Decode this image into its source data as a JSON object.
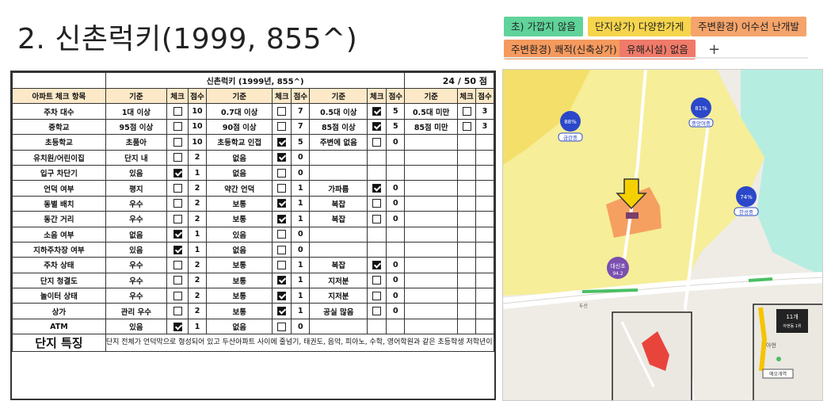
{
  "title": "2. 신촌럭키(1999, 855^)",
  "tags": [
    {
      "label": "초) 가깝지 않음",
      "color": "#5fd39a"
    },
    {
      "label": "단지상가) 다양한가게",
      "color": "#f6d54d"
    },
    {
      "label": "주변환경) 어수선 난개발",
      "color": "#f5a46b"
    },
    {
      "label": "주변환경) 쾌적(신축상가)",
      "color": "#f59a5e"
    },
    {
      "label": "유해시설) 없음",
      "color": "#f07a6a"
    }
  ],
  "tags_plus": "+",
  "checklist": {
    "complex_title": "신촌럭키 (1999년, 855^)",
    "score": "24 / 50 점",
    "headers": {
      "item": "아파트 체크 항목",
      "criteria": "기준",
      "check": "체크",
      "points": "점수"
    },
    "rows": [
      {
        "item": "주차 대수",
        "c": [
          [
            "1대 이상",
            false,
            "10"
          ],
          [
            "0.7대 이상",
            false,
            "7"
          ],
          [
            "0.5대 이상",
            true,
            "5"
          ],
          [
            "0.5대 미만",
            false,
            "3"
          ]
        ]
      },
      {
        "item": "중학교",
        "c": [
          [
            "95점 이상",
            false,
            "10"
          ],
          [
            "90점 이상",
            false,
            "7"
          ],
          [
            "85점 이상",
            true,
            "5"
          ],
          [
            "85점 미만",
            false,
            "3"
          ]
        ]
      },
      {
        "item": "초등학교",
        "c": [
          [
            "초품아",
            false,
            "10"
          ],
          [
            "초등학교 인접",
            true,
            "5"
          ],
          [
            "주변에 없음",
            false,
            "0"
          ],
          null
        ]
      },
      {
        "item": "유치원/어린이집",
        "c": [
          [
            "단지 내",
            false,
            "2"
          ],
          [
            "없음",
            true,
            "0"
          ],
          null,
          null
        ]
      },
      {
        "item": "입구 차단기",
        "c": [
          [
            "있음",
            true,
            "1"
          ],
          [
            "없음",
            false,
            "0"
          ],
          null,
          null
        ]
      },
      {
        "item": "언덕 여부",
        "c": [
          [
            "평지",
            false,
            "2"
          ],
          [
            "약간 언덕",
            false,
            "1"
          ],
          [
            "가파름",
            true,
            "0"
          ],
          null
        ]
      },
      {
        "item": "동별 배치",
        "c": [
          [
            "우수",
            false,
            "2"
          ],
          [
            "보통",
            true,
            "1"
          ],
          [
            "복잡",
            false,
            "0"
          ],
          null
        ]
      },
      {
        "item": "동간 거리",
        "c": [
          [
            "우수",
            false,
            "2"
          ],
          [
            "보통",
            true,
            "1"
          ],
          [
            "복잡",
            false,
            "0"
          ],
          null
        ]
      },
      {
        "item": "소음 여부",
        "c": [
          [
            "없음",
            true,
            "1"
          ],
          [
            "있음",
            false,
            "0"
          ],
          null,
          null
        ]
      },
      {
        "item": "지하주차장 여부",
        "c": [
          [
            "있음",
            true,
            "1"
          ],
          [
            "없음",
            false,
            "0"
          ],
          null,
          null
        ]
      },
      {
        "item": "주차 상태",
        "c": [
          [
            "우수",
            false,
            "2"
          ],
          [
            "보통",
            false,
            "1"
          ],
          [
            "복잡",
            true,
            "0"
          ],
          null
        ]
      },
      {
        "item": "단지 청결도",
        "c": [
          [
            "우수",
            false,
            "2"
          ],
          [
            "보통",
            true,
            "1"
          ],
          [
            "지저분",
            false,
            "0"
          ],
          null
        ]
      },
      {
        "item": "놀이터 상태",
        "c": [
          [
            "우수",
            false,
            "2"
          ],
          [
            "보통",
            true,
            "1"
          ],
          [
            "지저분",
            false,
            "0"
          ],
          null
        ]
      },
      {
        "item": "상가",
        "c": [
          [
            "관리 우수",
            false,
            "2"
          ],
          [
            "보통",
            true,
            "1"
          ],
          [
            "공실 많음",
            false,
            "0"
          ],
          null
        ]
      },
      {
        "item": "ATM",
        "c": [
          [
            "있음",
            true,
            "1"
          ],
          [
            "없음",
            false,
            "0"
          ],
          null,
          null
        ]
      }
    ],
    "features_label": "단지 특징",
    "features_text": "단지 전체가 언덕막으로 형성되어 있고 두산아파트 사이에 줄넘기, 태권도, 음악, 피아노, 수학, 영어학원과 같은 초등학생 저학년이 사용할 만한 학원상가와 마트가 입점해있음. 주차가 매우 복잡하고 지하주차장이 연결되어 있지 않음. 단지 구성은 신촌럭키가 좋으나 20평대 타입구조(방/화장실)로 인하여 두산을 선호하며 가격도 높음. 다양한 연령층이 거주중이며 아파트만의 거주만족도보다는 위치적으로 좋으며 관리 잘된 구축이다."
  },
  "map": {
    "school_markers": [
      {
        "pct": "88%",
        "name": "금란중"
      },
      {
        "pct": "81%",
        "name": "중앙여중"
      },
      {
        "pct": "74%",
        "name": "한성중"
      }
    ],
    "station_label": "대신초",
    "station_sub": "94.2",
    "inset_badge": "11개",
    "inset_badge_sub": "아현동 1위",
    "inset_station": "애오개역",
    "inset_text": "아현",
    "road_label": "두산",
    "colors": {
      "yellow_zone": "#f7ef8a",
      "cyan_zone": "#a8eee0",
      "orange_zone": "#f5a061",
      "arrow": "#f5d000"
    }
  }
}
